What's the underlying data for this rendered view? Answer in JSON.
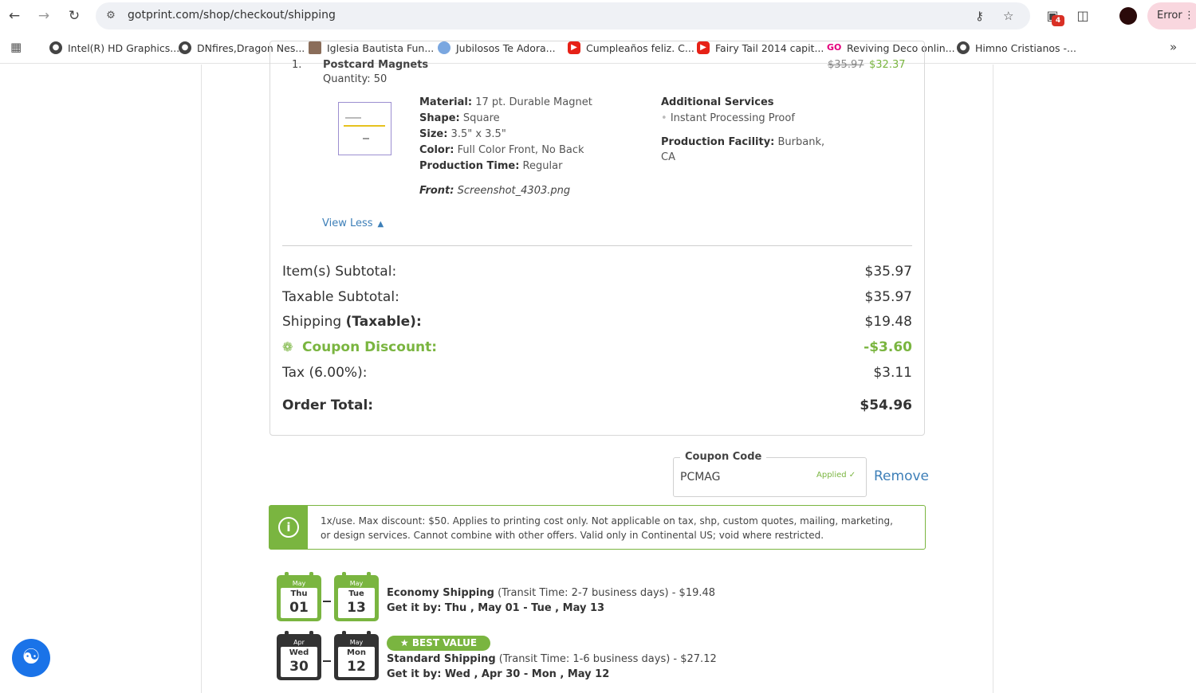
{
  "browser": {
    "url": "gotprint.com/shop/checkout/shipping",
    "error_label": "Error",
    "ext_badge": "4",
    "bookmarks": [
      {
        "label": "Intel(R) HD Graphics..."
      },
      {
        "label": "DNfires,Dragon Nes..."
      },
      {
        "label": "Iglesia Bautista Fun..."
      },
      {
        "label": "Jubilosos Te Adora..."
      },
      {
        "label": "Cumpleaños feliz. C..."
      },
      {
        "label": "Fairy Tail 2014 capit..."
      },
      {
        "label": "Reviving Deco onlin..."
      },
      {
        "label": "Himno Cristianos -..."
      }
    ]
  },
  "item": {
    "number": "1.",
    "name": "Postcard Magnets",
    "old_price": "$35.97",
    "new_price": "$32.37",
    "quantity": "Quantity: 50",
    "specs": {
      "material_label": "Material:",
      "material": "17 pt. Durable Magnet",
      "shape_label": "Shape:",
      "shape": "Square",
      "size_label": "Size:",
      "size": "3.5\" x 3.5\"",
      "color_label": "Color:",
      "color": "Full Color Front, No Back",
      "production_label": "Production Time:",
      "production": "Regular",
      "front_label": "Front:",
      "front": "Screenshot_4303.png"
    },
    "additional": {
      "title": "Additional Services",
      "service": "Instant Processing Proof",
      "facility_label": "Production Facility:",
      "facility_line1": "Burbank,",
      "facility_line2": "CA"
    },
    "view_less": "View Less"
  },
  "summary": {
    "subtotal_label": "Item(s) Subtotal:",
    "subtotal": "$35.97",
    "taxable_label": "Taxable Subtotal:",
    "taxable": "$35.97",
    "shipping_label": "Shipping",
    "shipping_taxable": "(Taxable):",
    "shipping": "$19.48",
    "coupon_label": "Coupon Discount:",
    "coupon": "-$3.60",
    "tax_label": "Tax (6.00%):",
    "tax": "$3.11",
    "total_label": "Order Total:",
    "total": "$54.96"
  },
  "coupon": {
    "legend": "Coupon Code",
    "value": "PCMAG",
    "applied": "Applied",
    "remove": "Remove",
    "info": "1x/use. Max discount: $50. Applies to printing cost only. Not applicable on tax, shp, custom quotes, mailing, marketing, or design services. Cannot combine with other offers. Valid only in Continental US; void where restricted."
  },
  "shipping": [
    {
      "from": {
        "month": "May",
        "dow": "Thu",
        "day": "01"
      },
      "to": {
        "month": "May",
        "dow": "Tue",
        "day": "13"
      },
      "name": "Economy Shipping",
      "detail": "(Transit Time: 2-7 business days) - $19.48",
      "get_it": "Get it by: Thu , May 01 - Tue , May 13"
    },
    {
      "badge": "BEST VALUE",
      "from": {
        "month": "Apr",
        "dow": "Wed",
        "day": "30"
      },
      "to": {
        "month": "May",
        "dow": "Mon",
        "day": "12"
      },
      "name": "Standard Shipping",
      "detail": "(Transit Time: 1-6 business days) - $27.12",
      "get_it": "Get it by: Wed , Apr 30 - Mon , May 12"
    }
  ],
  "colors": {
    "accent_green": "#7ab540",
    "link_blue": "#3d7fb8"
  }
}
